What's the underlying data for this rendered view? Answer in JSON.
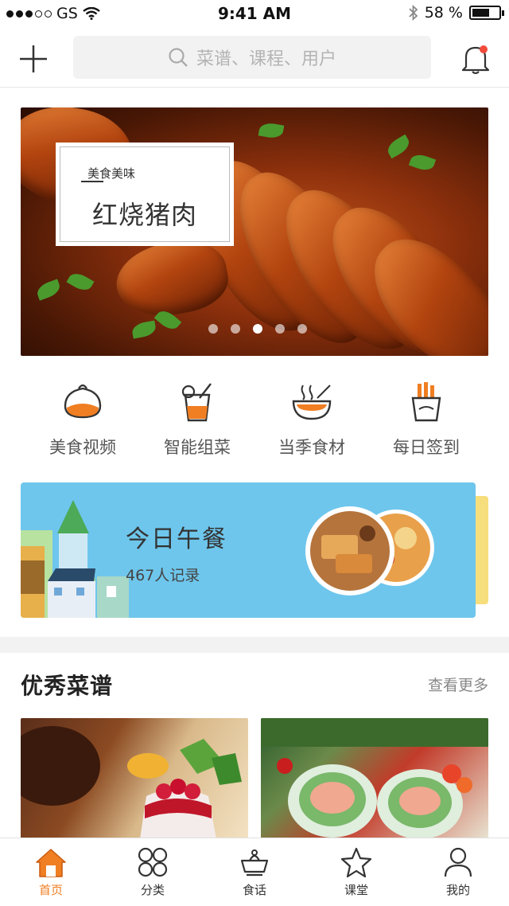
{
  "status_bar": {
    "carrier": "GS",
    "time": "9:41 AM",
    "battery": "58 %",
    "battery_level": 0.58
  },
  "header": {
    "search_placeholder": "菜谱、课程、用户",
    "add_icon": "plus-icon",
    "notification_icon": "bell-icon",
    "accent": "#f07e22"
  },
  "banner": {
    "tag": "美食美味",
    "title": "红烧猪肉",
    "slides": 5,
    "active_slide": 3
  },
  "categories": [
    {
      "label": "美食视频",
      "icon": "bun-icon"
    },
    {
      "label": "智能组菜",
      "icon": "drink-icon"
    },
    {
      "label": "当季食材",
      "icon": "noodle-bowl-icon"
    },
    {
      "label": "每日签到",
      "icon": "fries-icon"
    }
  ],
  "lunch_card": {
    "title": "今日午餐",
    "subtitle": "467人记录",
    "background": "#6ec6ec"
  },
  "recipes_section": {
    "title": "优秀菜谱",
    "more": "查看更多"
  },
  "tabbar": {
    "items": [
      {
        "label": "首页",
        "icon": "home-icon",
        "active": true
      },
      {
        "label": "分类",
        "icon": "category-icon",
        "active": false
      },
      {
        "label": "食话",
        "icon": "chat-pot-icon",
        "active": false
      },
      {
        "label": "课堂",
        "icon": "star-icon",
        "active": false
      },
      {
        "label": "我的",
        "icon": "user-icon",
        "active": false
      }
    ]
  }
}
